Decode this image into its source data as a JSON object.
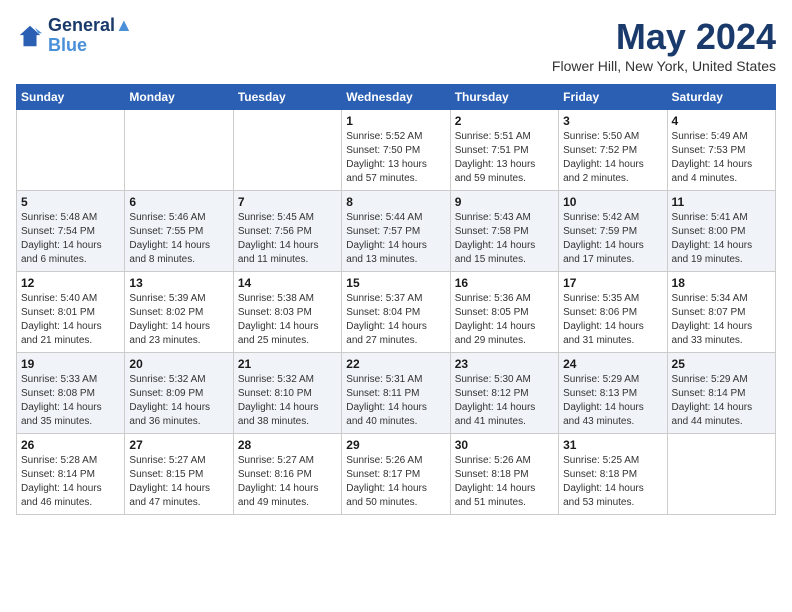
{
  "header": {
    "logo_line1": "General",
    "logo_line2": "Blue",
    "month_year": "May 2024",
    "location": "Flower Hill, New York, United States"
  },
  "weekdays": [
    "Sunday",
    "Monday",
    "Tuesday",
    "Wednesday",
    "Thursday",
    "Friday",
    "Saturday"
  ],
  "weeks": [
    [
      {
        "day": "",
        "info": ""
      },
      {
        "day": "",
        "info": ""
      },
      {
        "day": "",
        "info": ""
      },
      {
        "day": "1",
        "info": "Sunrise: 5:52 AM\nSunset: 7:50 PM\nDaylight: 13 hours and 57 minutes."
      },
      {
        "day": "2",
        "info": "Sunrise: 5:51 AM\nSunset: 7:51 PM\nDaylight: 13 hours and 59 minutes."
      },
      {
        "day": "3",
        "info": "Sunrise: 5:50 AM\nSunset: 7:52 PM\nDaylight: 14 hours and 2 minutes."
      },
      {
        "day": "4",
        "info": "Sunrise: 5:49 AM\nSunset: 7:53 PM\nDaylight: 14 hours and 4 minutes."
      }
    ],
    [
      {
        "day": "5",
        "info": "Sunrise: 5:48 AM\nSunset: 7:54 PM\nDaylight: 14 hours and 6 minutes."
      },
      {
        "day": "6",
        "info": "Sunrise: 5:46 AM\nSunset: 7:55 PM\nDaylight: 14 hours and 8 minutes."
      },
      {
        "day": "7",
        "info": "Sunrise: 5:45 AM\nSunset: 7:56 PM\nDaylight: 14 hours and 11 minutes."
      },
      {
        "day": "8",
        "info": "Sunrise: 5:44 AM\nSunset: 7:57 PM\nDaylight: 14 hours and 13 minutes."
      },
      {
        "day": "9",
        "info": "Sunrise: 5:43 AM\nSunset: 7:58 PM\nDaylight: 14 hours and 15 minutes."
      },
      {
        "day": "10",
        "info": "Sunrise: 5:42 AM\nSunset: 7:59 PM\nDaylight: 14 hours and 17 minutes."
      },
      {
        "day": "11",
        "info": "Sunrise: 5:41 AM\nSunset: 8:00 PM\nDaylight: 14 hours and 19 minutes."
      }
    ],
    [
      {
        "day": "12",
        "info": "Sunrise: 5:40 AM\nSunset: 8:01 PM\nDaylight: 14 hours and 21 minutes."
      },
      {
        "day": "13",
        "info": "Sunrise: 5:39 AM\nSunset: 8:02 PM\nDaylight: 14 hours and 23 minutes."
      },
      {
        "day": "14",
        "info": "Sunrise: 5:38 AM\nSunset: 8:03 PM\nDaylight: 14 hours and 25 minutes."
      },
      {
        "day": "15",
        "info": "Sunrise: 5:37 AM\nSunset: 8:04 PM\nDaylight: 14 hours and 27 minutes."
      },
      {
        "day": "16",
        "info": "Sunrise: 5:36 AM\nSunset: 8:05 PM\nDaylight: 14 hours and 29 minutes."
      },
      {
        "day": "17",
        "info": "Sunrise: 5:35 AM\nSunset: 8:06 PM\nDaylight: 14 hours and 31 minutes."
      },
      {
        "day": "18",
        "info": "Sunrise: 5:34 AM\nSunset: 8:07 PM\nDaylight: 14 hours and 33 minutes."
      }
    ],
    [
      {
        "day": "19",
        "info": "Sunrise: 5:33 AM\nSunset: 8:08 PM\nDaylight: 14 hours and 35 minutes."
      },
      {
        "day": "20",
        "info": "Sunrise: 5:32 AM\nSunset: 8:09 PM\nDaylight: 14 hours and 36 minutes."
      },
      {
        "day": "21",
        "info": "Sunrise: 5:32 AM\nSunset: 8:10 PM\nDaylight: 14 hours and 38 minutes."
      },
      {
        "day": "22",
        "info": "Sunrise: 5:31 AM\nSunset: 8:11 PM\nDaylight: 14 hours and 40 minutes."
      },
      {
        "day": "23",
        "info": "Sunrise: 5:30 AM\nSunset: 8:12 PM\nDaylight: 14 hours and 41 minutes."
      },
      {
        "day": "24",
        "info": "Sunrise: 5:29 AM\nSunset: 8:13 PM\nDaylight: 14 hours and 43 minutes."
      },
      {
        "day": "25",
        "info": "Sunrise: 5:29 AM\nSunset: 8:14 PM\nDaylight: 14 hours and 44 minutes."
      }
    ],
    [
      {
        "day": "26",
        "info": "Sunrise: 5:28 AM\nSunset: 8:14 PM\nDaylight: 14 hours and 46 minutes."
      },
      {
        "day": "27",
        "info": "Sunrise: 5:27 AM\nSunset: 8:15 PM\nDaylight: 14 hours and 47 minutes."
      },
      {
        "day": "28",
        "info": "Sunrise: 5:27 AM\nSunset: 8:16 PM\nDaylight: 14 hours and 49 minutes."
      },
      {
        "day": "29",
        "info": "Sunrise: 5:26 AM\nSunset: 8:17 PM\nDaylight: 14 hours and 50 minutes."
      },
      {
        "day": "30",
        "info": "Sunrise: 5:26 AM\nSunset: 8:18 PM\nDaylight: 14 hours and 51 minutes."
      },
      {
        "day": "31",
        "info": "Sunrise: 5:25 AM\nSunset: 8:18 PM\nDaylight: 14 hours and 53 minutes."
      },
      {
        "day": "",
        "info": ""
      }
    ]
  ]
}
